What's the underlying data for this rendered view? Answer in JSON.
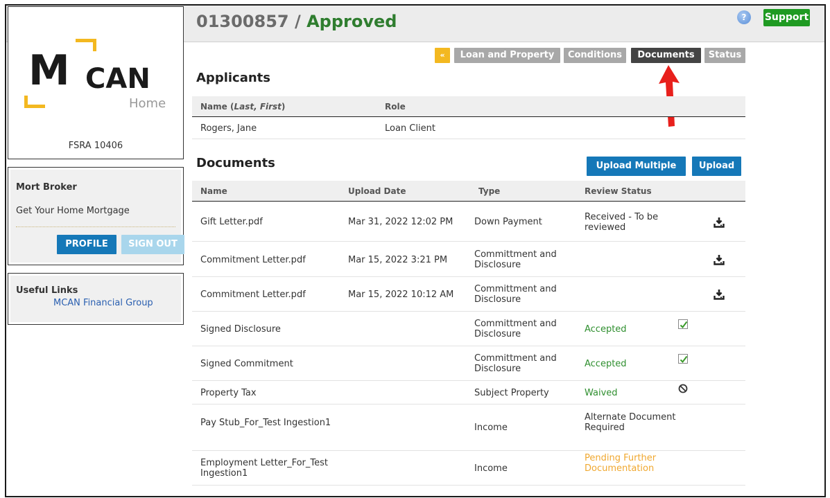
{
  "header": {
    "loan_number": "01300857",
    "separator": " / ",
    "loan_status": "Approved",
    "help_icon_text": "?",
    "support_label": "Support"
  },
  "sidebar": {
    "logo": {
      "m": "M",
      "can": "CAN",
      "home": "Home",
      "accent_color": "#f3b820"
    },
    "fsra": "FSRA 10406",
    "broker": {
      "name": "Mort Broker",
      "company": "Get Your Home Mortgage",
      "profile_label": "PROFILE",
      "signout_label": "SIGN OUT"
    },
    "useful_links": {
      "title": "Useful Links",
      "items": [
        "MCAN Financial Group"
      ]
    }
  },
  "tabs": {
    "collapse": "«",
    "items": [
      "Loan and Property",
      "Conditions",
      "Documents",
      "Status"
    ],
    "active": "Documents"
  },
  "applicants": {
    "title": "Applicants",
    "headers": {
      "name_prefix": "Name (",
      "name_italic": "Last, First",
      "name_suffix": ")",
      "role": "Role"
    },
    "rows": [
      {
        "name": "Rogers, Jane",
        "role": "Loan Client"
      }
    ]
  },
  "documents": {
    "title": "Documents",
    "upload_multiple_label": "Upload Multiple",
    "upload_label": "Upload",
    "headers": [
      "Name",
      "Upload Date",
      "Type",
      "Review Status"
    ],
    "rows": [
      {
        "name": "Gift Letter.pdf",
        "date": "Mar 31, 2022 12:02 PM",
        "type": "Down Payment",
        "status": "Received - To be reviewed",
        "icon": "download-icon"
      },
      {
        "name": "Commitment Letter.pdf",
        "date": "Mar 15, 2022 3:21 PM",
        "type": "Committment and Disclosure",
        "status": "",
        "icon": "download-icon"
      },
      {
        "name": "Commitment Letter.pdf",
        "date": "Mar 15, 2022 10:12 AM",
        "type": "Committment and Disclosure",
        "status": "",
        "icon": "download-icon"
      },
      {
        "name": "Signed Disclosure",
        "date": "",
        "type": "Committment and Disclosure",
        "status": "Accepted",
        "icon": "checkmark-icon"
      },
      {
        "name": "Signed Commitment",
        "date": "",
        "type": "Committment and Disclosure",
        "status": "Accepted",
        "icon": "checkmark-icon"
      },
      {
        "name": "Property Tax",
        "date": "",
        "type": "Subject Property",
        "status": "Waived",
        "icon": "waived-icon"
      },
      {
        "name": "Pay Stub_For_Test Ingestion1",
        "date": "",
        "type": "Income",
        "status": "Alternate Document Required",
        "icon": ""
      },
      {
        "name": "Employment Letter_For_Test Ingestion1",
        "date": "",
        "type": "Income",
        "status": "Pending Further Documentation",
        "icon": ""
      }
    ]
  },
  "colors": {
    "approved_green": "#2f7d2f",
    "accepted_green": "#2f8f2f",
    "pending_orange": "#f0a830",
    "primary_blue": "#1578b8",
    "support_green": "#1f9a22",
    "annotation_red": "#e8201c"
  }
}
